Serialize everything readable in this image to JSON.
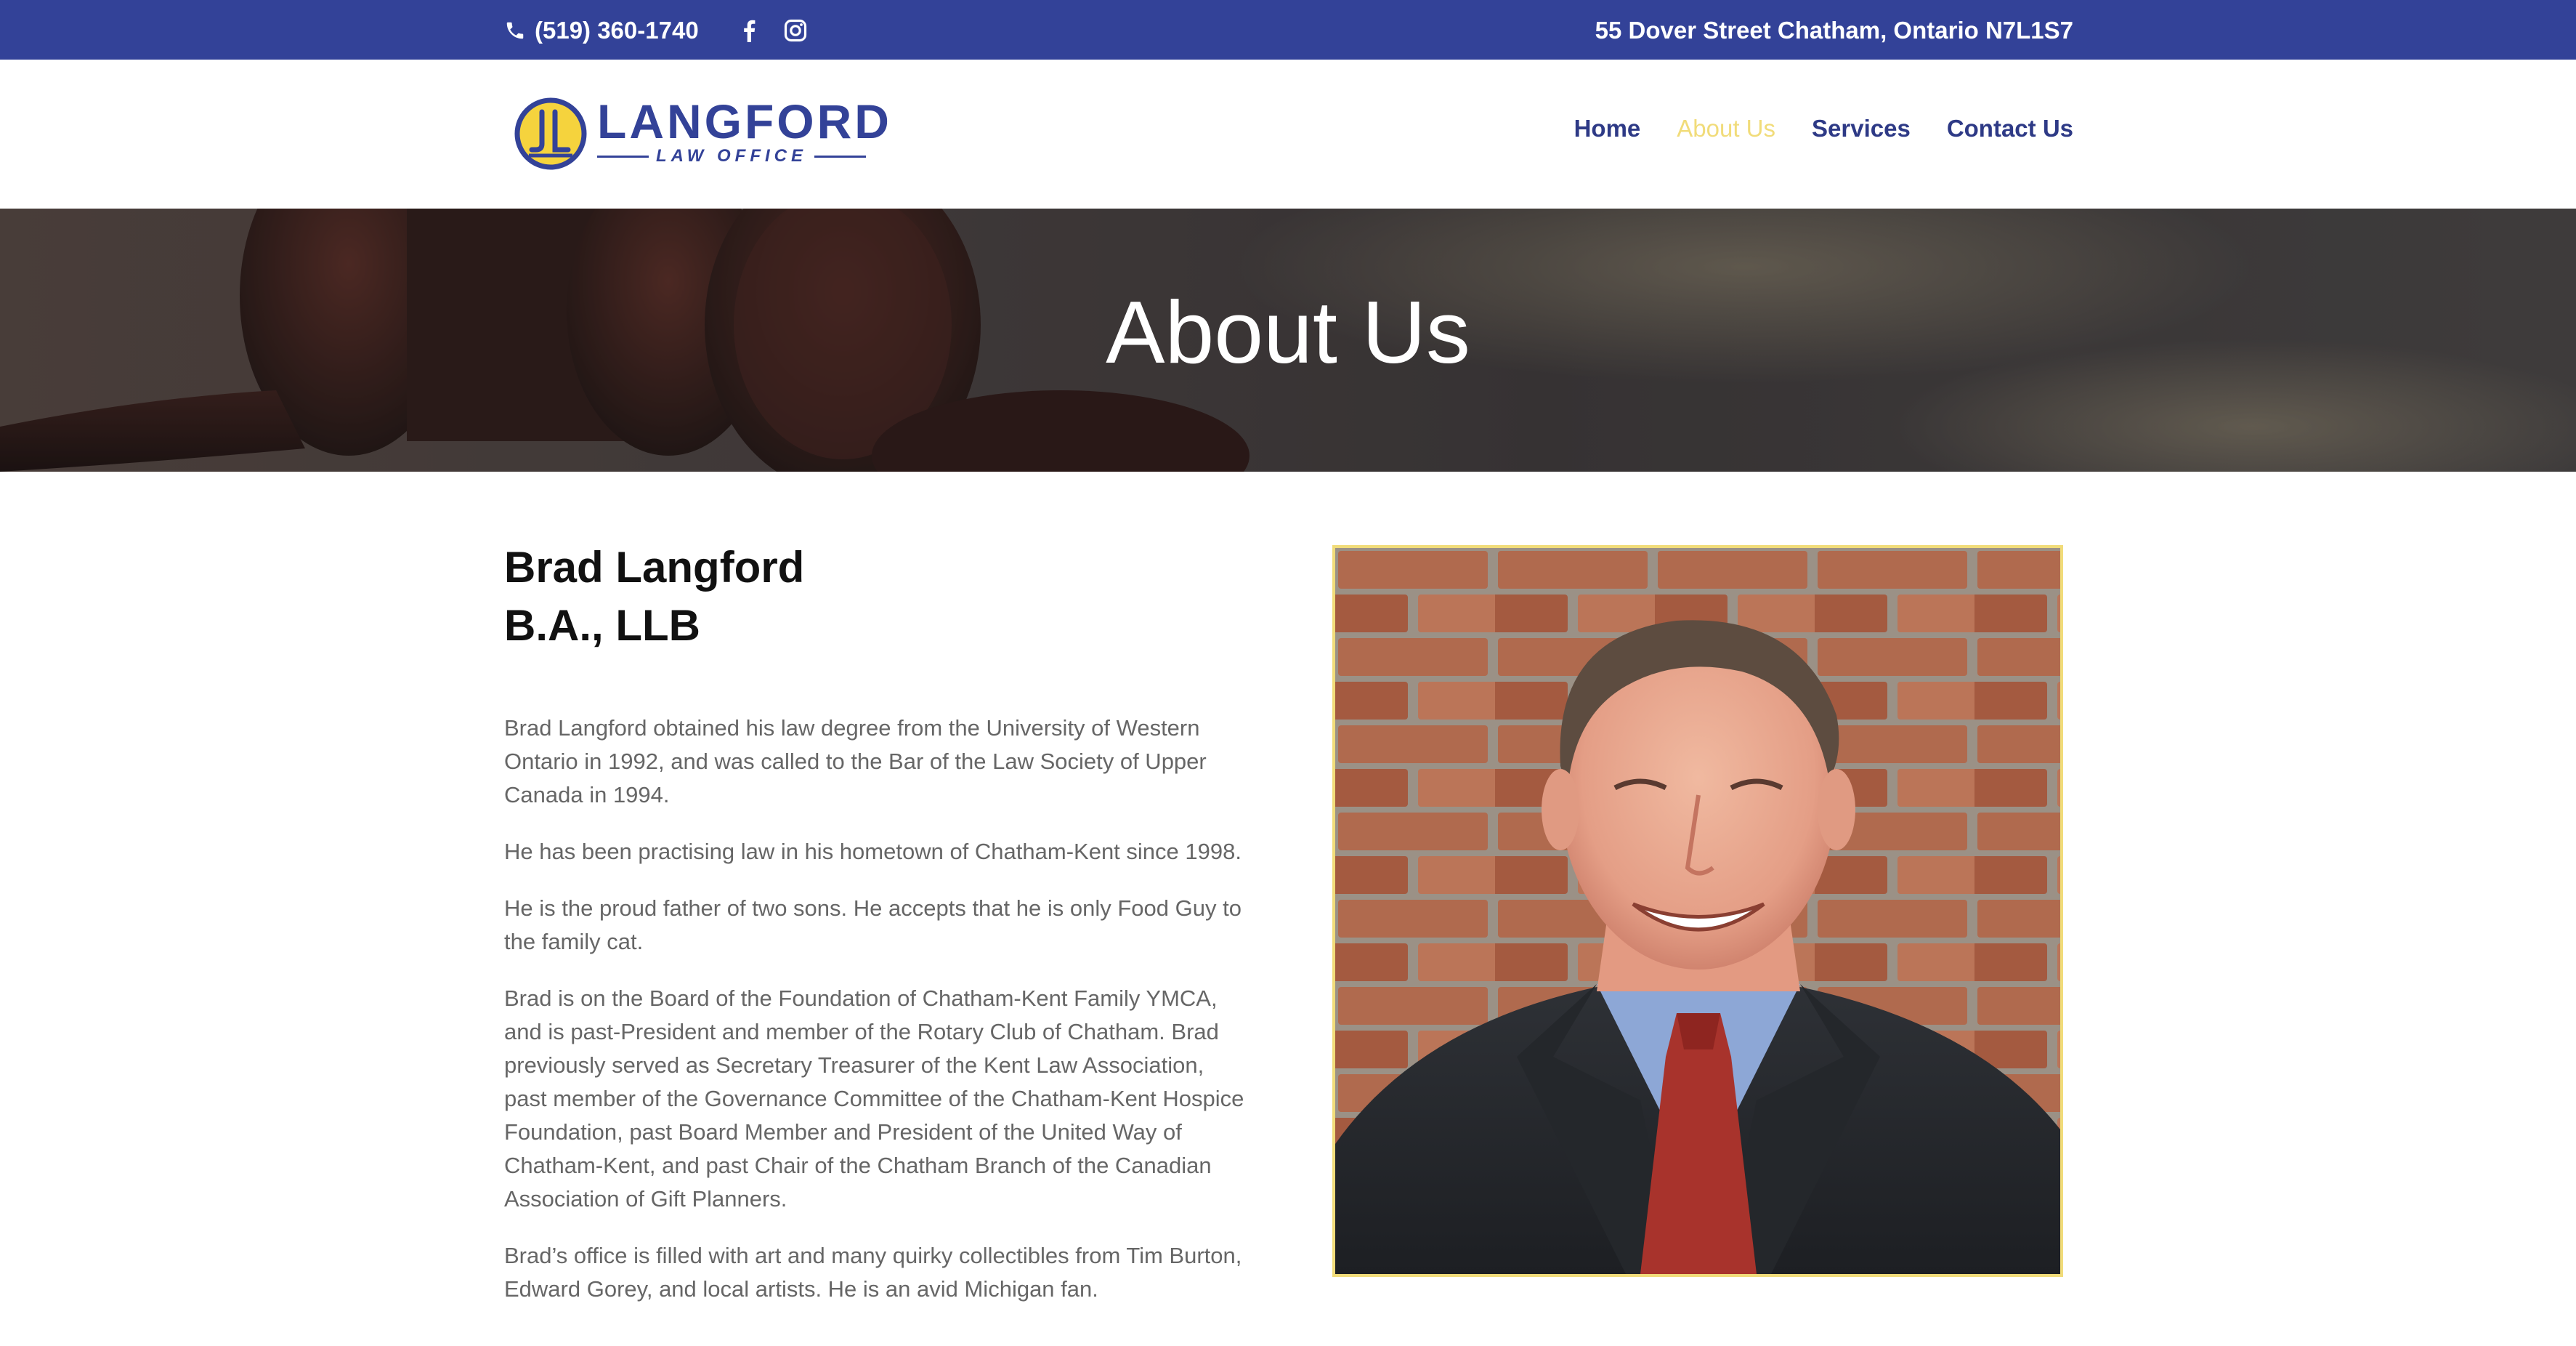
{
  "topbar": {
    "phone": "(519) 360-1740",
    "phone_icon": "phone-icon",
    "social": [
      {
        "name": "facebook-icon"
      },
      {
        "name": "instagram-icon"
      }
    ],
    "address": "55 Dover Street Chatham, Ontario N7L1S7"
  },
  "header": {
    "logo": {
      "brand": "LANGFORD",
      "subtitle": "LAW OFFICE"
    },
    "nav": [
      {
        "label": "Home",
        "active": false
      },
      {
        "label": "About Us",
        "active": true
      },
      {
        "label": "Services",
        "active": false
      },
      {
        "label": "Contact Us",
        "active": false
      }
    ]
  },
  "hero": {
    "title": "About Us"
  },
  "bio": {
    "name": "Brad Langford",
    "credentials": "B.A., LLB",
    "paragraphs": [
      "Brad Langford obtained his law degree from the University of Western Ontario in 1992, and was called to the Bar of the Law Society of Upper Canada in 1994.",
      "He has been practising law in his hometown of Chatham-Kent since 1998.",
      "He is the proud father of two sons. He accepts that he is only Food Guy to the family cat.",
      "Brad is on the Board of the Foundation of Chatham-Kent Family YMCA, and is past-President and member of the Rotary Club of Chatham. Brad previously served as Secretary Treasurer of the Kent Law Association, past member of the Governance Committee of the Chatham-Kent Hospice Foundation, past Board Member and President of the United Way of Chatham-Kent, and past Chair of the Chatham Branch of the Canadian Association of Gift Planners.",
      "Brad’s office is filled with art and many quirky collectibles from Tim Burton, Edward Gorey, and local artists. He is an avid Michigan fan."
    ]
  },
  "colors": {
    "brand_blue": "#334298",
    "accent_yellow": "#f1dc7a",
    "nav_text": "#2e3a86",
    "body_text": "#666666"
  }
}
